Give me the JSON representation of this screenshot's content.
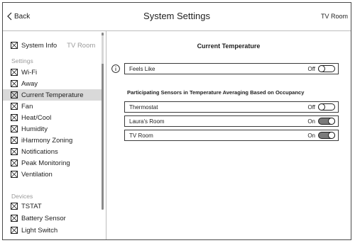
{
  "header": {
    "back_label": "Back",
    "title": "System Settings",
    "room": "TV Room"
  },
  "sidebar": {
    "system_info": {
      "label": "System Info",
      "room": "TV Room"
    },
    "settings_heading": "Settings",
    "settings_items": [
      {
        "label": "Wi-Fi"
      },
      {
        "label": "Away"
      },
      {
        "label": "Current Temperature",
        "selected": true
      },
      {
        "label": "Fan"
      },
      {
        "label": "Heat/Cool"
      },
      {
        "label": "Humidity"
      },
      {
        "label": "iHarmony Zoning"
      },
      {
        "label": "Notifications"
      },
      {
        "label": "Peak Monitoring"
      },
      {
        "label": "Ventilation"
      }
    ],
    "devices_heading": "Devices",
    "device_items": [
      {
        "label": "TSTAT"
      },
      {
        "label": "Battery Sensor"
      },
      {
        "label": "Light Switch"
      }
    ]
  },
  "main": {
    "title": "Current Temperature",
    "feels_like": {
      "label": "Feels Like",
      "state": "Off"
    },
    "sensors_heading": "Participating Sensors in Temperature Averaging Based on Occupancy",
    "sensors": [
      {
        "label": "Thermostat",
        "state": "Off"
      },
      {
        "label": "Laura's Room",
        "state": "On"
      },
      {
        "label": "TV Room",
        "state": "On"
      }
    ]
  },
  "colors": {
    "border": "#4a4a4a",
    "selected_row": "#d9d9d9",
    "toggle_on": "#7a7a7a",
    "muted_text": "#9a9a9a"
  }
}
